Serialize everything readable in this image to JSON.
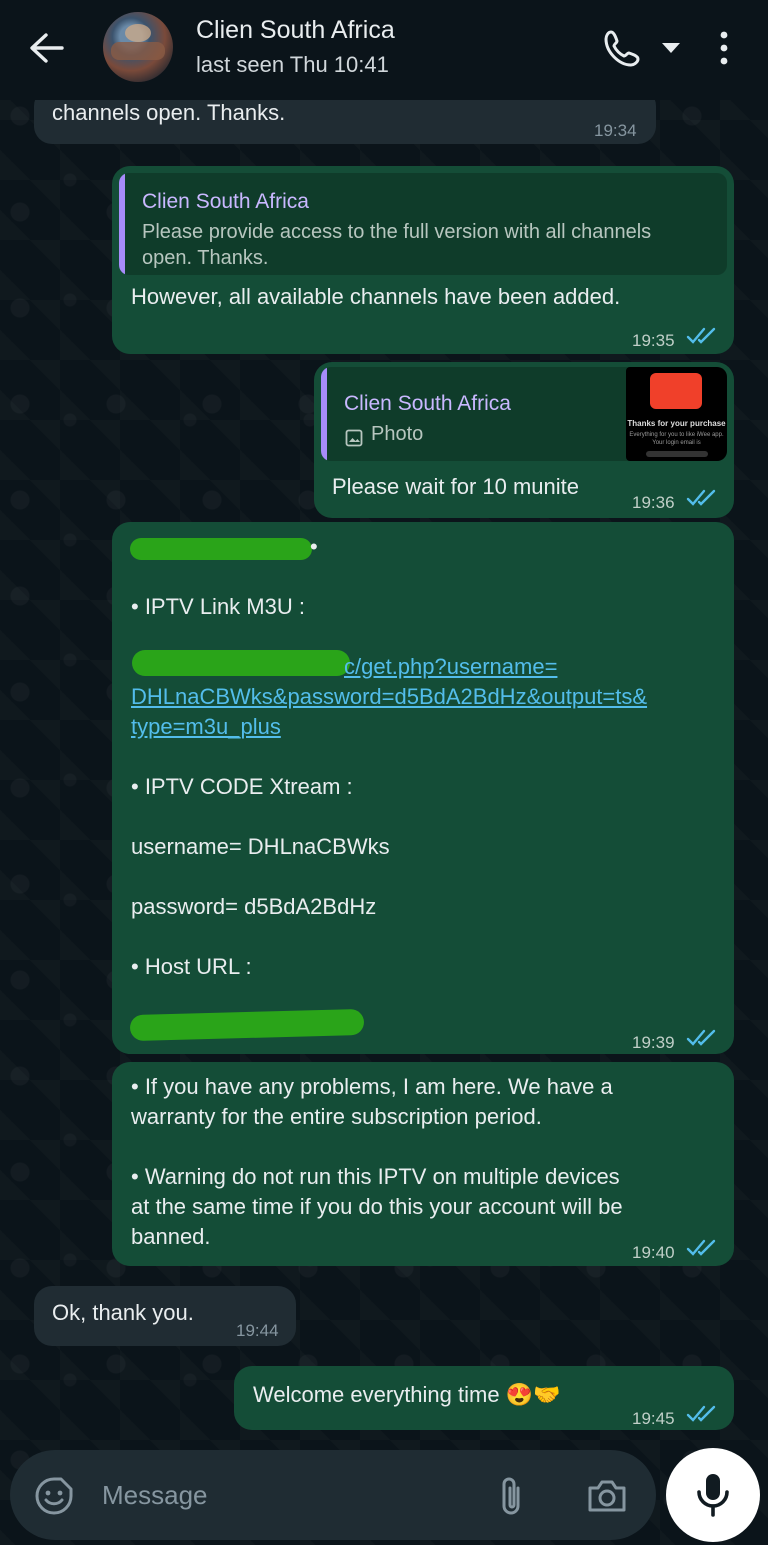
{
  "header": {
    "contact_name": "Clien South Africa",
    "last_seen": "last seen Thu 10:41"
  },
  "messages": [
    {
      "id": "m1",
      "direction": "in",
      "text": "channels open. Thanks.",
      "time": "19:34"
    },
    {
      "id": "m2",
      "direction": "out",
      "quote": {
        "name": "Clien South Africa",
        "text": "Please provide access to the full version with all channels\nopen. Thanks."
      },
      "text": "However, all available channels have been added.",
      "time": "19:35",
      "status": "read"
    },
    {
      "id": "m3",
      "direction": "out",
      "quote": {
        "name": "Clien South Africa",
        "text": "Photo",
        "thumb_title": "Thanks for your purchase",
        "thumb_sub": "Everything for you to like iWee app.\nYour login email is"
      },
      "text": "Please wait for 10 munite",
      "time": "19:36",
      "status": "read"
    },
    {
      "id": "m4",
      "direction": "out",
      "lines": {
        "bullet_tail": "•",
        "m3u_label": "• IPTV Link M3U :",
        "link_1": "c/get.php?username=",
        "link_2": "DHLnaCBWks&password=d5BdA2BdHz&output=ts&",
        "link_3": "type=m3u_plus",
        "xtream_label": "• IPTV CODE Xtream :",
        "username": "username= DHLnaCBWks",
        "password": "password= d5BdA2BdHz",
        "host_label": "• Host URL :"
      },
      "time": "19:39",
      "status": "read"
    },
    {
      "id": "m5",
      "direction": "out",
      "text": "• If you have any problems, I am here. We have a\nwarranty for the entire subscription period.\n\n• Warning do not run this IPTV on multiple devices\nat the same time if you do this your account will be\nbanned.",
      "time": "19:40",
      "status": "read"
    },
    {
      "id": "m6",
      "direction": "in",
      "text": "Ok, thank you.",
      "time": "19:44"
    },
    {
      "id": "m7",
      "direction": "out",
      "text": "Welcome everything time 😍🤝",
      "time": "19:45",
      "status": "read"
    }
  ],
  "composer": {
    "placeholder": "Message"
  },
  "colors": {
    "background": "#0b141a",
    "incoming_bubble": "#202c33",
    "outgoing_bubble": "#144d37",
    "read_ticks": "#53bdeb",
    "quote_bar": "#a78bfa",
    "link": "#53bdeb",
    "redaction": "#2aa419"
  },
  "icons": [
    "back-arrow-icon",
    "phone-icon",
    "caret-down-icon",
    "more-vert-icon",
    "sticker-icon",
    "attach-icon",
    "camera-icon",
    "mic-icon",
    "image-icon",
    "double-check-icon"
  ]
}
